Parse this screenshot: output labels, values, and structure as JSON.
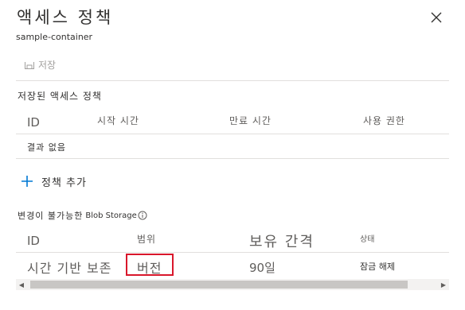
{
  "panel": {
    "title": "액세스 정책",
    "subtitle": "sample-container"
  },
  "toolbar": {
    "save_label": "저장"
  },
  "stored_policies": {
    "heading": "저장된 액세스 정책",
    "columns": [
      "ID",
      "시작 시간",
      "만료 시간",
      "사용 권한"
    ],
    "empty_text": "결과 없음",
    "add_label": "정책 추가"
  },
  "immutable": {
    "heading_prefix": "변경이 불가능한",
    "heading_storage": "Blob Storage",
    "columns": [
      "ID",
      "범위",
      "보유 간격",
      "상태"
    ],
    "rows": [
      {
        "id": "시간 기반 보존",
        "scope": "버전",
        "retention": "90일",
        "status": "잠금 해제"
      }
    ]
  },
  "colors": {
    "highlight_border": "#d9172b",
    "accent": "#0078d4"
  },
  "icons": {
    "close": "close-icon",
    "save": "save-icon",
    "add": "plus-icon",
    "info": "info-icon"
  }
}
